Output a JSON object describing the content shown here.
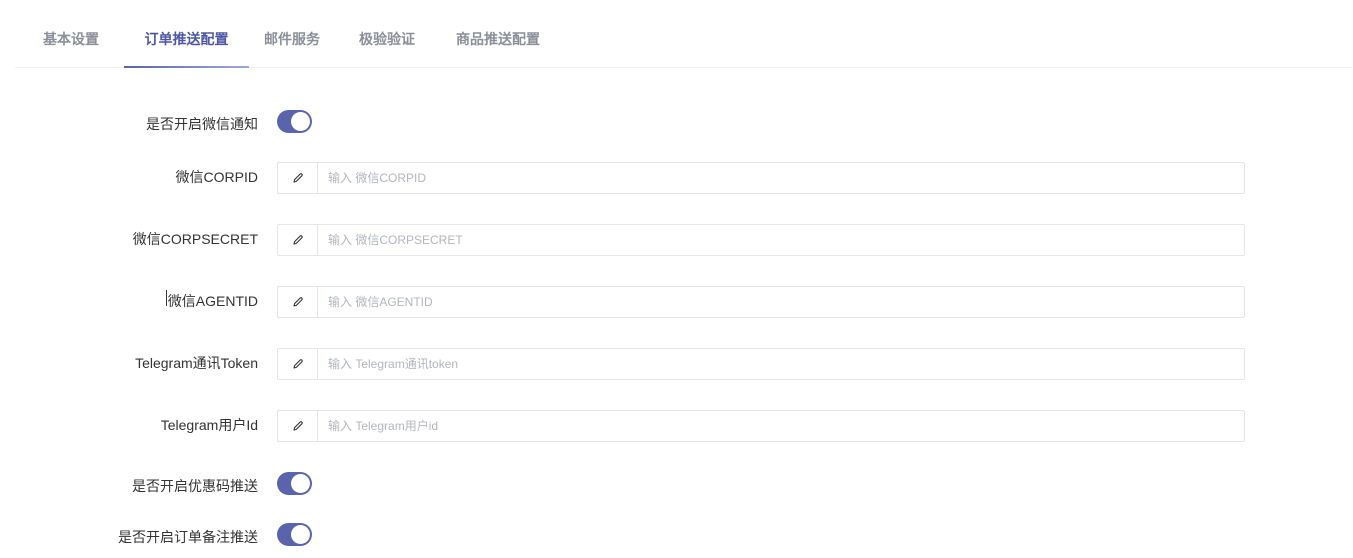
{
  "tabs": [
    {
      "label": "基本设置",
      "active": false
    },
    {
      "label": "订单推送配置",
      "active": true
    },
    {
      "label": "邮件服务",
      "active": false
    },
    {
      "label": "极验验证",
      "active": false
    },
    {
      "label": "商品推送配置",
      "active": false
    }
  ],
  "form": {
    "wechat_notify": {
      "label": "是否开启微信通知",
      "enabled": true
    },
    "corpid": {
      "label": "微信CORPID",
      "placeholder": "输入 微信CORPID",
      "value": ""
    },
    "corpsecret": {
      "label": "微信CORPSECRET",
      "placeholder": "输入 微信CORPSECRET",
      "value": ""
    },
    "agentid": {
      "label": "微信AGENTID",
      "placeholder": "输入 微信AGENTID",
      "value": ""
    },
    "telegram_token": {
      "label": "Telegram通讯Token",
      "placeholder": "输入 Telegram通讯token",
      "value": ""
    },
    "telegram_userid": {
      "label": "Telegram用户Id",
      "placeholder": "输入 Telegram用户id",
      "value": ""
    },
    "coupon_push": {
      "label": "是否开启优惠码推送",
      "enabled": true
    },
    "order_note_push": {
      "label": "是否开启订单备注推送",
      "enabled": true
    }
  },
  "icons": {
    "field_addon": "pencil-icon"
  },
  "colors": {
    "accent": "#5a64ad",
    "active_tab": "#4c56a5",
    "inactive_tab": "#8a8f99"
  }
}
